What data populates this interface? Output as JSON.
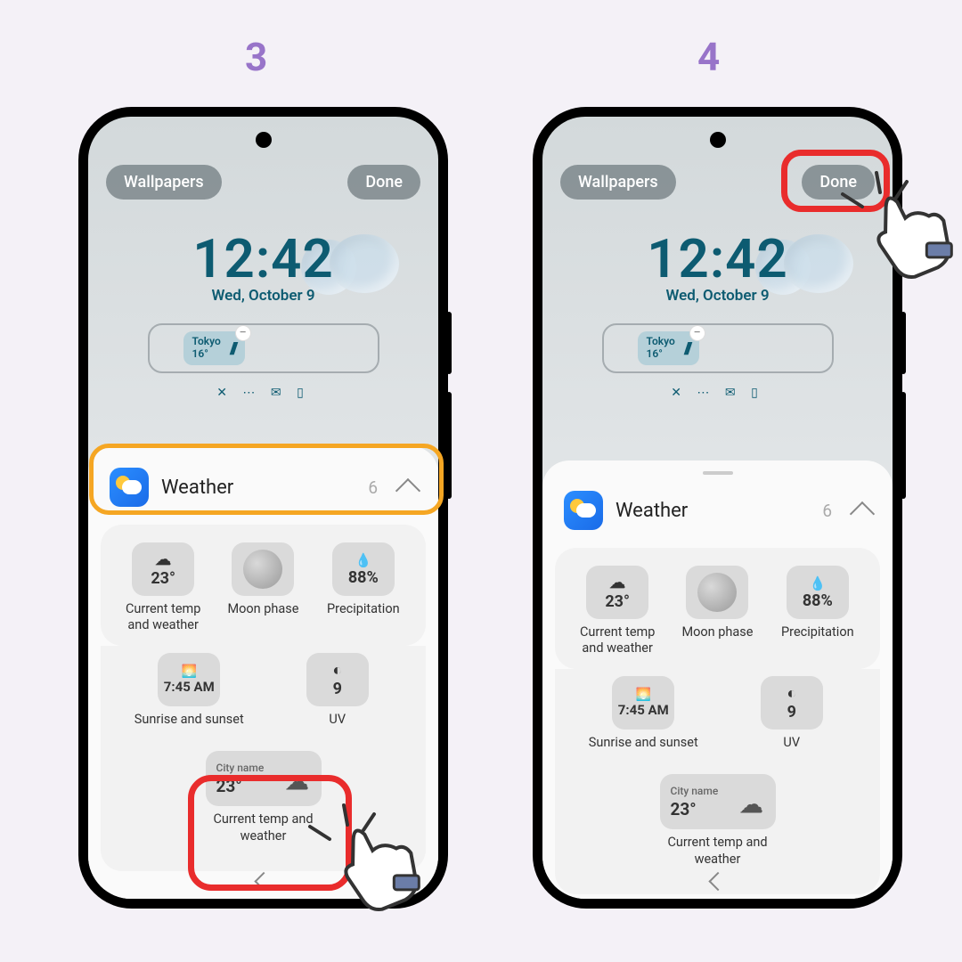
{
  "steps": {
    "left": "3",
    "right": "4"
  },
  "top": {
    "wallpapers": "Wallpapers",
    "done": "Done"
  },
  "clock": {
    "time": "12:42",
    "date": "Wed, October 9"
  },
  "chip": {
    "city": "Tokyo",
    "temp": "16°"
  },
  "sheet": {
    "title": "Weather",
    "count": "6"
  },
  "widgets": {
    "w1": {
      "val": "23°",
      "label": "Current temp and weather"
    },
    "w2": {
      "label": "Moon phase"
    },
    "w3": {
      "val": "88%",
      "label": "Precipitation"
    },
    "w4": {
      "val": "7:45 AM",
      "label": "Sunrise and sunset"
    },
    "w5": {
      "val": "9",
      "label": "UV"
    },
    "w6": {
      "city": "City name",
      "val": "23°",
      "label": "Current temp and weather"
    }
  }
}
